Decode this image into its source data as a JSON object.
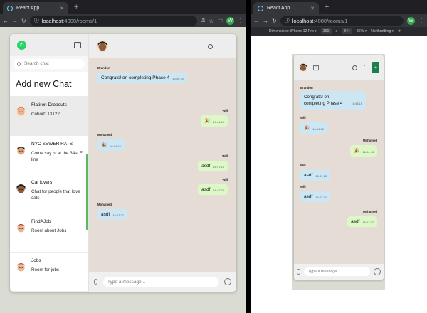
{
  "browser_left": {
    "tab_title": "React App",
    "url_host": "localhost",
    "url_path": ":4000/rooms/1",
    "profile_initial": "W"
  },
  "browser_right": {
    "tab_title": "React App",
    "url_host": "localhost",
    "url_path": ":4000/rooms/1",
    "profile_initial": "W",
    "devtools": {
      "dimensions": "Dimensions: iPhone 12 Pro ▾",
      "width": "390",
      "x": "x",
      "height": "844",
      "zoom": "86% ▾",
      "throttle": "No throttling ▾"
    }
  },
  "sidebar": {
    "search_placeholder": "Search chat",
    "add_new": "Add new Chat",
    "rooms": [
      {
        "name": "Flatiron Dropouts",
        "last": "Cohort: 13122!"
      },
      {
        "name": "NYC SEWER RATS",
        "last": "Come say hi at the 34st F line"
      },
      {
        "name": "Cat lovers",
        "last": "Chat for people that love cats"
      },
      {
        "name": "FindAJob",
        "last": "Room about Jobs"
      },
      {
        "name": "Jobs",
        "last": "Room for jobs"
      }
    ]
  },
  "messages": [
    {
      "name": "Brandon",
      "text": "Congrats! on completing Phase 4",
      "time": "16:44:16",
      "side": "recv"
    },
    {
      "name": "Will",
      "text": "🎉",
      "time": "16:44:18",
      "side": "sent"
    },
    {
      "name": "Mohamed",
      "text": "🎉",
      "time": "16:44:18",
      "side": "recv"
    },
    {
      "name": "Will",
      "text": "asdf",
      "time": "16:47:15",
      "side": "sent"
    },
    {
      "name": "Will",
      "text": "asdf",
      "time": "16:47:24",
      "side": "sent"
    },
    {
      "name": "Mohamed",
      "text": "asdf",
      "time": "16:47:27",
      "side": "recv"
    }
  ],
  "messages_mobile": [
    {
      "name": "Brandon",
      "text": "Congrats! on completing Phase 4",
      "time": "16:44:16",
      "side": "recv"
    },
    {
      "name": "Will",
      "text": "🎉",
      "time": "16:44:18",
      "side": "recv"
    },
    {
      "name": "Mohamed",
      "text": "🎉",
      "time": "16:44:18",
      "side": "sent"
    },
    {
      "name": "Will",
      "text": "asdf",
      "time": "16:47:15",
      "side": "recv"
    },
    {
      "name": "Will",
      "text": "asdf",
      "time": "16:47:24",
      "side": "recv"
    },
    {
      "name": "Mohamed",
      "text": "asdf",
      "time": "16:47:27",
      "side": "sent"
    }
  ],
  "composer": {
    "placeholder": "Type a message..."
  },
  "colors": {
    "accent": "#25d366",
    "sent_bubble": "#dcf8c6",
    "recv_bubble": "#cde6f3",
    "chat_bg": "#e5ddd5"
  }
}
